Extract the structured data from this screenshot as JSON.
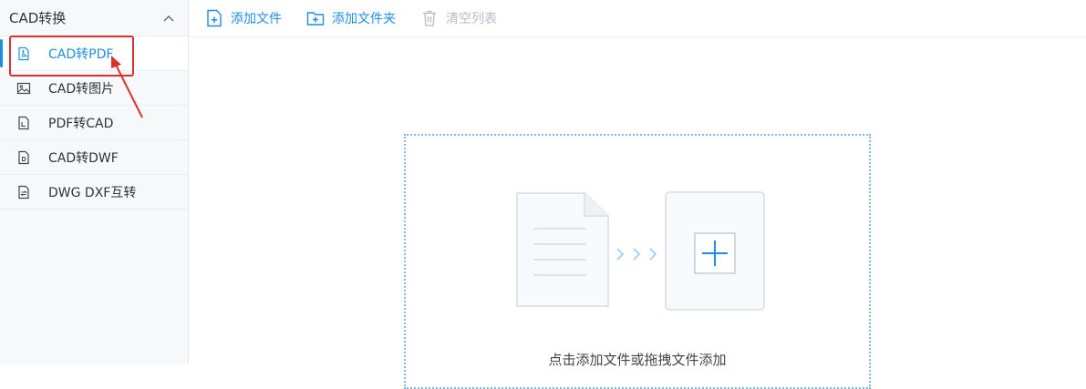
{
  "sidebar": {
    "header": {
      "title": "CAD转换",
      "icon": "chevron-up-icon"
    },
    "items": [
      {
        "label": "CAD转PDF",
        "icon": "pdf-file-icon",
        "active": true
      },
      {
        "label": "CAD转图片",
        "icon": "image-icon",
        "active": false
      },
      {
        "label": "PDF转CAD",
        "icon": "cad-file-icon",
        "active": false
      },
      {
        "label": "CAD转DWF",
        "icon": "dwf-file-icon",
        "active": false
      },
      {
        "label": "DWG DXF互转",
        "icon": "swap-file-icon",
        "active": false
      }
    ]
  },
  "toolbar": {
    "add_file": "添加文件",
    "add_folder": "添加文件夹",
    "clear_list": "清空列表"
  },
  "dropzone": {
    "hint": "点击添加文件或拖拽文件添加"
  },
  "colors": {
    "accent": "#1d8ee0",
    "annotation": "#d9322c",
    "disabled": "#b8bcc2"
  }
}
